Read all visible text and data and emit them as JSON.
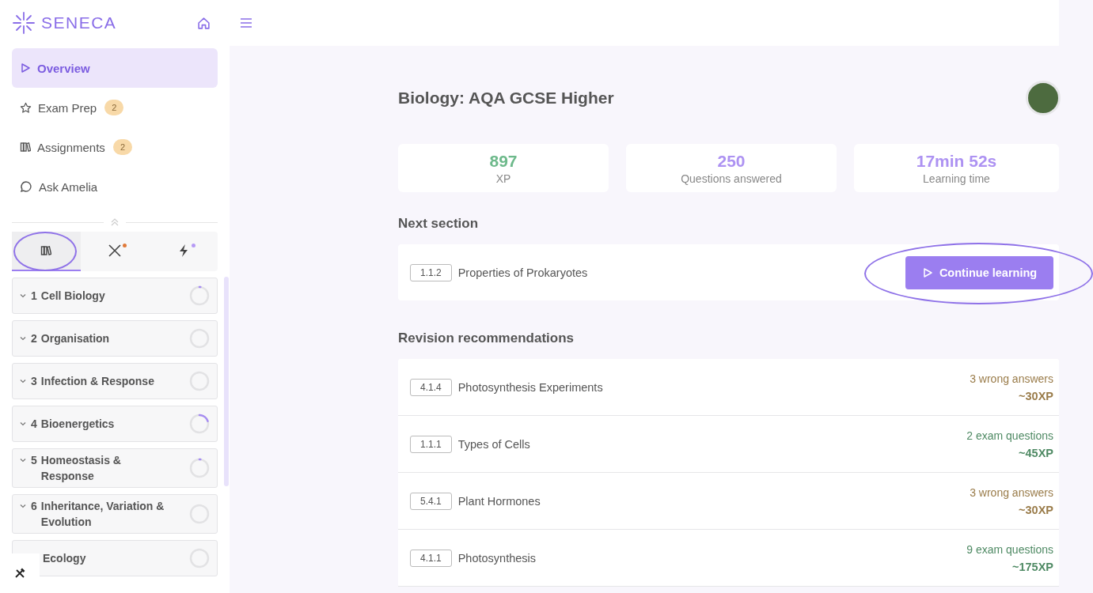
{
  "sidebar": {
    "logo": "SENECA",
    "nav": [
      {
        "label": "Overview",
        "selected": true
      },
      {
        "label": "Exam Prep",
        "badge": "2",
        "selected": false
      },
      {
        "label": "Assignments",
        "badge": "2",
        "selected": false
      },
      {
        "label": "Ask Amelia",
        "selected": false
      }
    ],
    "tabs": [
      {
        "selected": true,
        "highlighted": true
      },
      {
        "selected": false,
        "color": "#e07a3a"
      },
      {
        "selected": false,
        "color": "#b69af5"
      }
    ],
    "topics": [
      {
        "number": "1",
        "title": "Cell Biology",
        "level": 0.02
      },
      {
        "number": "2",
        "title": "Organisation"
      },
      {
        "number": "3",
        "title": "Infection & Response"
      },
      {
        "number": "4",
        "title": "Bioenergetics",
        "level": 0.2
      },
      {
        "number": "5",
        "title": "Homeostasis & Response",
        "level": 0.02
      },
      {
        "number": "6",
        "title": "Inheritance, Variation & Evolution"
      },
      {
        "title": "Ecology"
      }
    ]
  },
  "main": {
    "title": "Biology: AQA GCSE Higher",
    "stats": [
      {
        "value": "897",
        "label": "XP",
        "kind": "xp"
      },
      {
        "value": "250",
        "label": "Questions answered",
        "kind": "count"
      },
      {
        "value": "17min 52s",
        "label": "Learning time",
        "kind": "time"
      }
    ],
    "next_section": {
      "heading": "Next section",
      "code": "1.1.2",
      "title": "Properties of Prokaryotes",
      "button": {
        "label": "Continue learning",
        "highlighted": true
      }
    },
    "revision": {
      "heading": "Revision recommendations",
      "items": [
        {
          "code": "4.1.4",
          "title": "Photosynthesis Experiments",
          "reason": "3 wrong answers",
          "xp": "~30XP",
          "kind": "wrong"
        },
        {
          "code": "1.1.1",
          "title": "Types of Cells",
          "reason": "2 exam questions",
          "xp": "~45XP",
          "kind": "exam"
        },
        {
          "code": "5.4.1",
          "title": "Plant Hormones",
          "reason": "3 wrong answers",
          "xp": "~30XP",
          "kind": "wrong"
        },
        {
          "code": "4.1.1",
          "title": "Photosynthesis",
          "reason": "9 exam questions",
          "xp": "~175XP",
          "kind": "exam"
        }
      ]
    }
  }
}
